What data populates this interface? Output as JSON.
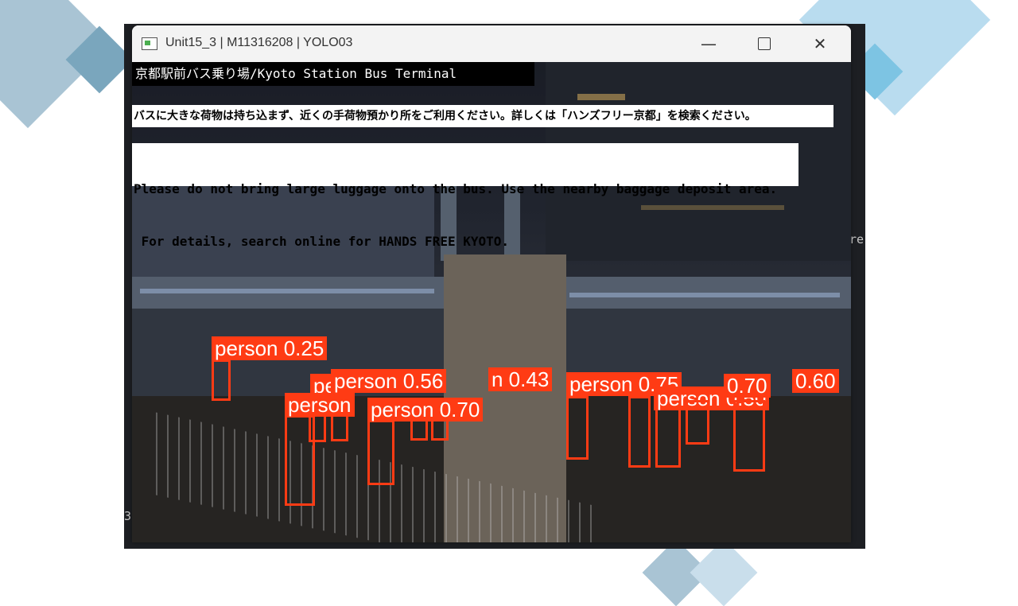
{
  "window": {
    "title": "Unit15_3 | M11316208 | YOLO03",
    "minimize_symbol": "—",
    "close_symbol": "✕"
  },
  "desktop": {
    "glyph_right": "re",
    "glyph_left": "3"
  },
  "video": {
    "banner_title": "京都駅前バス乗り場/Kyoto Station Bus Terminal",
    "banner_jp": "バスに大きな荷物は持ち込まず、近くの手荷物預かり所をご利用ください。詳しくは「ハンズフリー京都」を検索ください。",
    "banner_en_line1": "Please do not bring large luggage onto the bus. Use the nearby baggage deposit area.",
    "banner_en_line2": " For details, search online for HANDS FREE KYOTO."
  },
  "detections": [
    {
      "label": "person 0.25"
    },
    {
      "label": "person 0.56"
    },
    {
      "label": "n 0.43"
    },
    {
      "label": "person 0.70"
    },
    {
      "label": "person"
    },
    {
      "label": "person 0.75"
    },
    {
      "label": "0.70"
    },
    {
      "label": "0.60"
    },
    {
      "label": "person 0.50"
    },
    {
      "label": "pe"
    }
  ],
  "colors": {
    "detection": "#ff3b14",
    "titlebar": "#f3f3f3"
  }
}
